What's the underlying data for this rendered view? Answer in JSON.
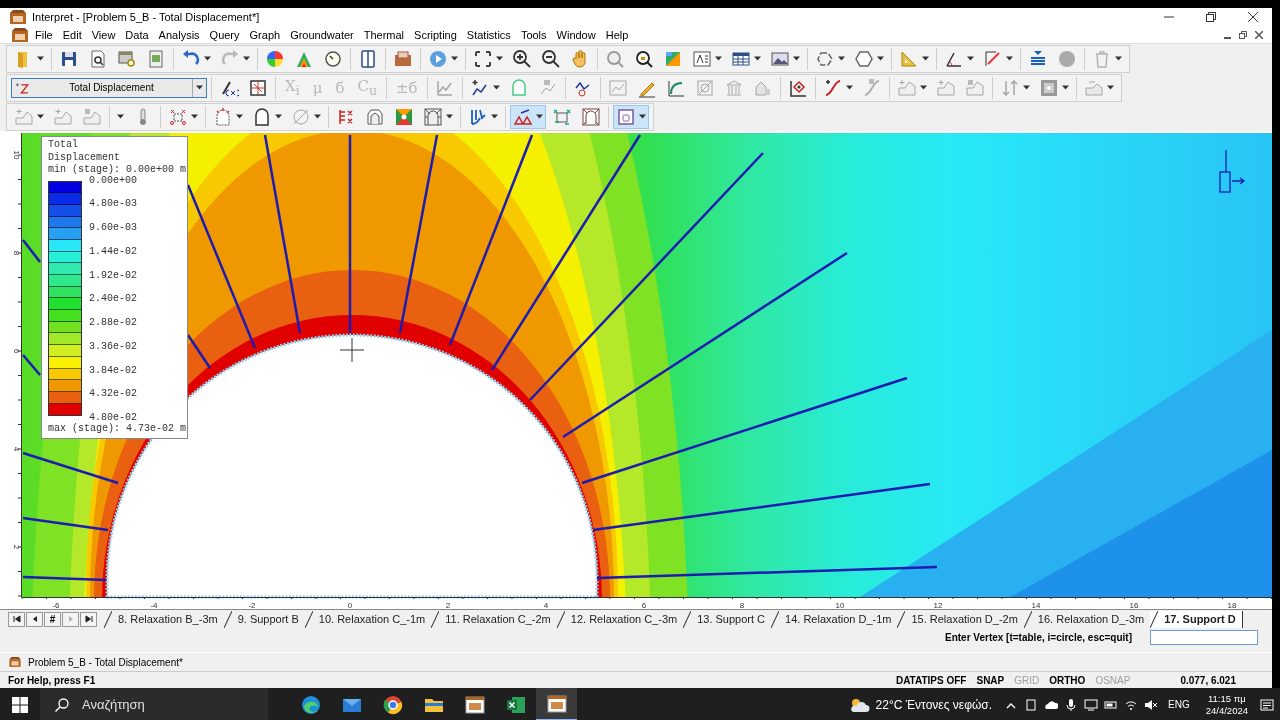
{
  "window": {
    "title": "Interpret - [Problem 5_B - Total Displacement*]"
  },
  "menu": [
    "File",
    "Edit",
    "View",
    "Data",
    "Analysis",
    "Query",
    "Graph",
    "Groundwater",
    "Thermal",
    "Scripting",
    "Statistics",
    "Tools",
    "Window",
    "Help"
  ],
  "toolbars": [
    {
      "groups": [
        [
          {
            "kind": "folder",
            "dropdown": true
          }
        ],
        [
          {
            "kind": "floppy"
          },
          {
            "kind": "page-search"
          },
          {
            "kind": "window-search"
          },
          {
            "kind": "document"
          }
        ],
        [
          {
            "kind": "undo-arrow",
            "dropdown": true
          },
          {
            "kind": "redo-arrow",
            "dropdown": true,
            "disabled": true
          }
        ],
        [
          {
            "kind": "color-wheel"
          },
          {
            "kind": "contour-triangle"
          },
          {
            "kind": "dial"
          }
        ],
        [
          {
            "kind": "columns"
          }
        ],
        [
          {
            "kind": "folder-image"
          }
        ],
        [
          {
            "kind": "play-circle",
            "dropdown": true
          }
        ],
        [
          {
            "kind": "expand-arrows",
            "dropdown": true
          },
          {
            "kind": "zoom-in"
          },
          {
            "kind": "zoom-out"
          },
          {
            "kind": "hand-pan"
          }
        ],
        [
          {
            "kind": "magnifier"
          },
          {
            "kind": "magnifier-lock"
          },
          {
            "kind": "color-grid"
          },
          {
            "kind": "text-box",
            "dropdown": true
          },
          {
            "kind": "table",
            "dropdown": true
          },
          {
            "kind": "picture",
            "dropdown": true
          }
        ],
        [
          {
            "kind": "lasso",
            "dropdown": true
          },
          {
            "kind": "hexagon",
            "dropdown": true
          }
        ],
        [
          {
            "kind": "set-square",
            "dropdown": true
          }
        ],
        [
          {
            "kind": "angle",
            "dropdown": true
          },
          {
            "kind": "measure-line",
            "dropdown": true
          }
        ],
        [
          {
            "kind": "align-lines"
          },
          {
            "kind": "filled-circle"
          }
        ],
        [
          {
            "kind": "trash",
            "dropdown": true,
            "disabled": true
          }
        ]
      ]
    },
    {
      "groups": [
        [
          {
            "kind": "combo",
            "value": "Total Displacement"
          }
        ],
        [
          {
            "kind": "function"
          },
          {
            "kind": "grid-square"
          }
        ],
        [
          {
            "kind": "symbol",
            "label": "X$_{i}$",
            "disabled": true
          },
          {
            "kind": "symbol",
            "label": "μ",
            "disabled": true
          },
          {
            "kind": "symbol",
            "label": "б",
            "disabled": true
          },
          {
            "kind": "symbol",
            "label": "C$_{u}$",
            "disabled": true
          }
        ],
        [
          {
            "kind": "symbol",
            "label": "±б",
            "disabled": true
          }
        ],
        [
          {
            "kind": "chart-line",
            "disabled": true
          }
        ],
        [
          {
            "kind": "curve-plus",
            "dropdown": true
          },
          {
            "kind": "rounded-box"
          },
          {
            "kind": "node-delete",
            "disabled": true
          }
        ],
        [
          {
            "kind": "graph-points"
          }
        ],
        [
          {
            "kind": "line-graph",
            "disabled": true
          },
          {
            "kind": "pencil"
          },
          {
            "kind": "curve-axis"
          },
          {
            "kind": "box-slash",
            "disabled": true
          },
          {
            "kind": "pillars",
            "disabled": true
          },
          {
            "kind": "house",
            "disabled": true
          }
        ],
        [
          {
            "kind": "axis-target"
          }
        ],
        [
          {
            "kind": "bolt-line",
            "dropdown": true
          },
          {
            "kind": "bolt-delete",
            "disabled": true
          }
        ],
        [
          {
            "kind": "shape-add",
            "dropdown": true,
            "disabled": true
          },
          {
            "kind": "shape-add",
            "disabled": true
          },
          {
            "kind": "shape-delete",
            "disabled": true
          }
        ],
        [
          {
            "kind": "arrows",
            "dropdown": true,
            "disabled": true
          },
          {
            "kind": "hatch-square",
            "dropdown": true
          }
        ],
        [
          {
            "kind": "layer",
            "dropdown": true,
            "disabled": true
          }
        ]
      ]
    },
    {
      "groups": [
        [
          {
            "kind": "surface-add",
            "dropdown": true,
            "disabled": true
          },
          {
            "kind": "surface-add",
            "disabled": true
          },
          {
            "kind": "surface-delete",
            "disabled": true
          }
        ],
        [
          {
            "kind": "blank",
            "dropdown": true
          },
          {
            "kind": "thermometer"
          }
        ],
        [
          {
            "kind": "point-grid",
            "dropdown": true
          }
        ],
        [
          {
            "kind": "house-dash",
            "dropdown": true
          },
          {
            "kind": "tunnel-outline",
            "dropdown": true
          },
          {
            "kind": "circle-slash",
            "dropdown": true,
            "disabled": true
          }
        ],
        [
          {
            "kind": "bars-crosses"
          },
          {
            "kind": "roof-box"
          },
          {
            "kind": "color-tile"
          },
          {
            "kind": "mesh-tunnel",
            "dropdown": true
          }
        ],
        [
          {
            "kind": "fan-lines",
            "dropdown": true
          }
        ],
        [
          {
            "kind": "triangles",
            "dropdown": true,
            "pressed": true
          },
          {
            "kind": "points-move"
          },
          {
            "kind": "mesh-frame"
          }
        ],
        [
          {
            "kind": "frame-square",
            "dropdown": true,
            "pressed": true
          }
        ]
      ]
    }
  ],
  "plot": {
    "y_ticks": [
      "10",
      "8",
      "6",
      "4",
      "2"
    ],
    "x_ticks": [
      "-6",
      "-4",
      "-2",
      "0",
      "2",
      "4",
      "6",
      "8",
      "10",
      "12",
      "14",
      "16",
      "18"
    ],
    "legend": {
      "title": "Total Displacement",
      "min_label": "min (stage): 0.00e+00 m",
      "max_label": "max (stage): 4.73e-02 m",
      "labels": [
        "0.00e+00",
        "4.80e-03",
        "9.60e-03",
        "1.44e-02",
        "1.92e-02",
        "2.40e-02",
        "2.88e-02",
        "3.36e-02",
        "3.84e-02",
        "4.32e-02",
        "4.80e-02"
      ],
      "bands": [
        {
          "color": "#0000e0"
        },
        {
          "color": "#0a2ce8"
        },
        {
          "color": "#1450e8"
        },
        {
          "color": "#1e78ee"
        },
        {
          "color": "#28a0f2"
        },
        {
          "color": "#28e8f8"
        },
        {
          "color": "#28f0d8"
        },
        {
          "color": "#30e8b0"
        },
        {
          "color": "#30e88c"
        },
        {
          "color": "#30e060"
        },
        {
          "color": "#20e030"
        },
        {
          "color": "#44e020"
        },
        {
          "color": "#70e020"
        },
        {
          "color": "#a0e828"
        },
        {
          "color": "#d0ee20"
        },
        {
          "color": "#f8f000"
        },
        {
          "color": "#f8c800"
        },
        {
          "color": "#f09800"
        },
        {
          "color": "#e86010"
        },
        {
          "color": "#e00000"
        }
      ]
    }
  },
  "stage_nav": [
    {
      "kind": "first"
    },
    {
      "kind": "previous"
    },
    {
      "kind": "number",
      "label": "#"
    },
    {
      "kind": "next",
      "disabled": true
    },
    {
      "kind": "last"
    }
  ],
  "stage_tabs": [
    {
      "label": "8. Relaxation B_-3m",
      "selected": false
    },
    {
      "label": "9. Support B",
      "selected": false
    },
    {
      "label": "10. Relaxation C_-1m",
      "selected": false
    },
    {
      "label": "11. Relaxation C_-2m",
      "selected": false
    },
    {
      "label": "12. Relaxation C_-3m",
      "selected": false
    },
    {
      "label": "13. Support C",
      "selected": false
    },
    {
      "label": "14. Relaxation D_-1m",
      "selected": false
    },
    {
      "label": "15. Relaxation D_-2m",
      "selected": false
    },
    {
      "label": "16. Relaxation D_-3m",
      "selected": false
    },
    {
      "label": "17. Support D",
      "selected": true
    }
  ],
  "command": {
    "prompt": "Enter Vertex [t=table, i=circle, esc=quit]"
  },
  "document_tab": "Problem 5_B - Total Displacement*",
  "status_bar": {
    "help": "For Help, press F1",
    "toggles": [
      {
        "label": "DATATIPS OFF",
        "on": true
      },
      {
        "label": "SNAP",
        "on": true
      },
      {
        "label": "GRID",
        "on": false
      },
      {
        "label": "ORTHO",
        "on": true
      },
      {
        "label": "OSNAP",
        "on": false
      }
    ],
    "coordinates": "0.077, 6.021"
  },
  "taskbar": {
    "search_placeholder": "Αναζήτηση",
    "apps": [
      {
        "kind": "swirl",
        "selected": false
      },
      {
        "kind": "envelope",
        "selected": false
      },
      {
        "kind": "segmented-circle",
        "selected": false
      },
      {
        "kind": "folder",
        "selected": false
      },
      {
        "kind": "app-window",
        "selected": false
      },
      {
        "kind": "spreadsheet",
        "selected": false
      },
      {
        "kind": "app-window",
        "selected": true
      }
    ],
    "weather": "22°C Έντονες νεφώσ.",
    "language": "ENG",
    "time": "11:15 πμ",
    "date": "24/4/2024"
  }
}
